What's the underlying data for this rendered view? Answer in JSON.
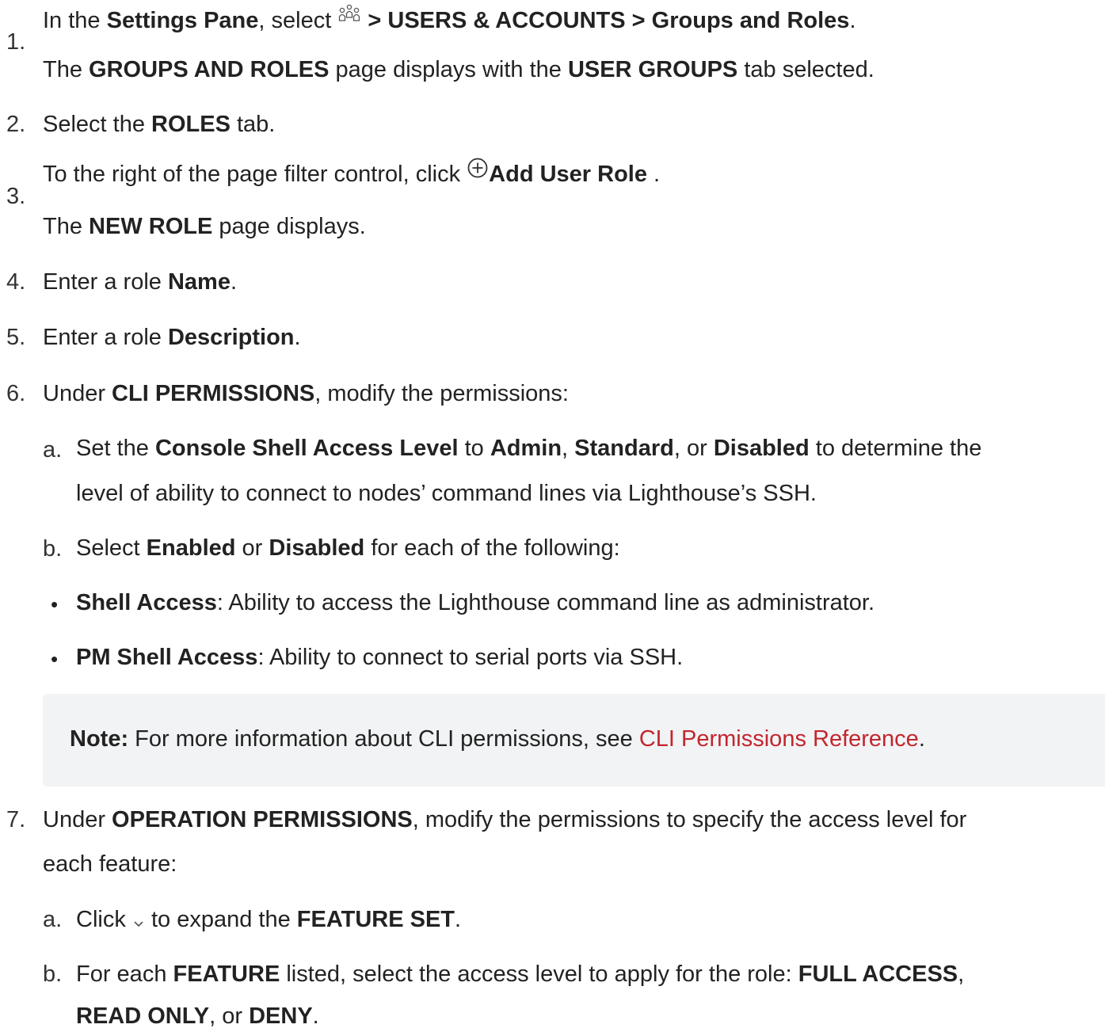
{
  "steps": [
    {
      "num": "1.",
      "line1": {
        "t1": "In the ",
        "b1": "Settings Pane",
        "t2": ", select ",
        "b2": " > USERS & ACCOUNTS > Groups and Roles",
        "t3": "."
      },
      "line2": {
        "t1": "The ",
        "b1": "GROUPS AND ROLES",
        "t2": " page displays with the ",
        "b2": "USER GROUPS",
        "t3": " tab selected."
      }
    },
    {
      "num": "2.",
      "line1": {
        "t1": "Select the ",
        "b1": "ROLES",
        "t2": " tab."
      }
    },
    {
      "num": "3.",
      "line1": {
        "t1": "To the right of the page filter control, click ",
        "b1": "Add User Role",
        "t2": " ."
      },
      "line2": {
        "t1": "The ",
        "b1": "NEW ROLE",
        "t2": " page displays."
      }
    },
    {
      "num": "4.",
      "line1": {
        "t1": "Enter a role ",
        "b1": "Name",
        "t2": "."
      }
    },
    {
      "num": "5.",
      "line1": {
        "t1": "Enter a role ",
        "b1": "Description",
        "t2": "."
      }
    },
    {
      "num": "6.",
      "line1": {
        "t1": "Under ",
        "b1": "CLI PERMISSIONS",
        "t2": ", modify the permissions:"
      },
      "sub_a": {
        "label": "a.",
        "line1": {
          "t1": "Set the ",
          "b1": "Console Shell Access Level",
          "t2": " to ",
          "b2": "Admin",
          "t3": ", ",
          "b3": "Standard",
          "t4": ", or ",
          "b4": "Disabled",
          "t5": " to determine the"
        },
        "line2": "level of ability to connect to nodes’ command lines via Lighthouse’s SSH."
      },
      "sub_b": {
        "label": "b.",
        "line1": {
          "t1": "Select ",
          "b1": "Enabled",
          "t2": " or ",
          "b2": "Disabled",
          "t3": " for each of the following:"
        }
      },
      "bullets": [
        {
          "b": "Shell Access",
          "t": ": Ability to access the Lighthouse command line as administrator."
        },
        {
          "b": "PM Shell Access",
          "t": ": Ability to connect to serial ports via SSH."
        }
      ],
      "note": {
        "label": "Note:",
        "text": " For more information about CLI permissions, see ",
        "link": "CLI Permissions Reference",
        "end": "."
      }
    },
    {
      "num": "7.",
      "line1": {
        "t1": "Under ",
        "b1": "OPERATION PERMISSIONS",
        "t2": ", modify the permissions to specify the access level for"
      },
      "line2": "each feature:",
      "sub_a": {
        "label": "a.",
        "line1": {
          "t1": "Click ",
          "t2": " to expand the ",
          "b1": "FEATURE SET",
          "t3": "."
        }
      },
      "sub_b": {
        "label": "b.",
        "line1": {
          "t1": "For each ",
          "b1": "FEATURE",
          "t2": " listed, select the access level to apply for the role: ",
          "b2": "FULL ACCESS",
          "t3": ","
        },
        "line2": {
          "b1": "READ ONLY",
          "t1": ", or ",
          "b2": "DENY",
          "t2": "."
        }
      }
    }
  ],
  "icons": {
    "users": "users-icon",
    "add": "plus-circle-icon",
    "expand": "chevron-down-icon"
  },
  "colors": {
    "text": "#222222",
    "link": "#c2262e",
    "note_bg": "#f2f3f4",
    "icon": "#555555"
  }
}
